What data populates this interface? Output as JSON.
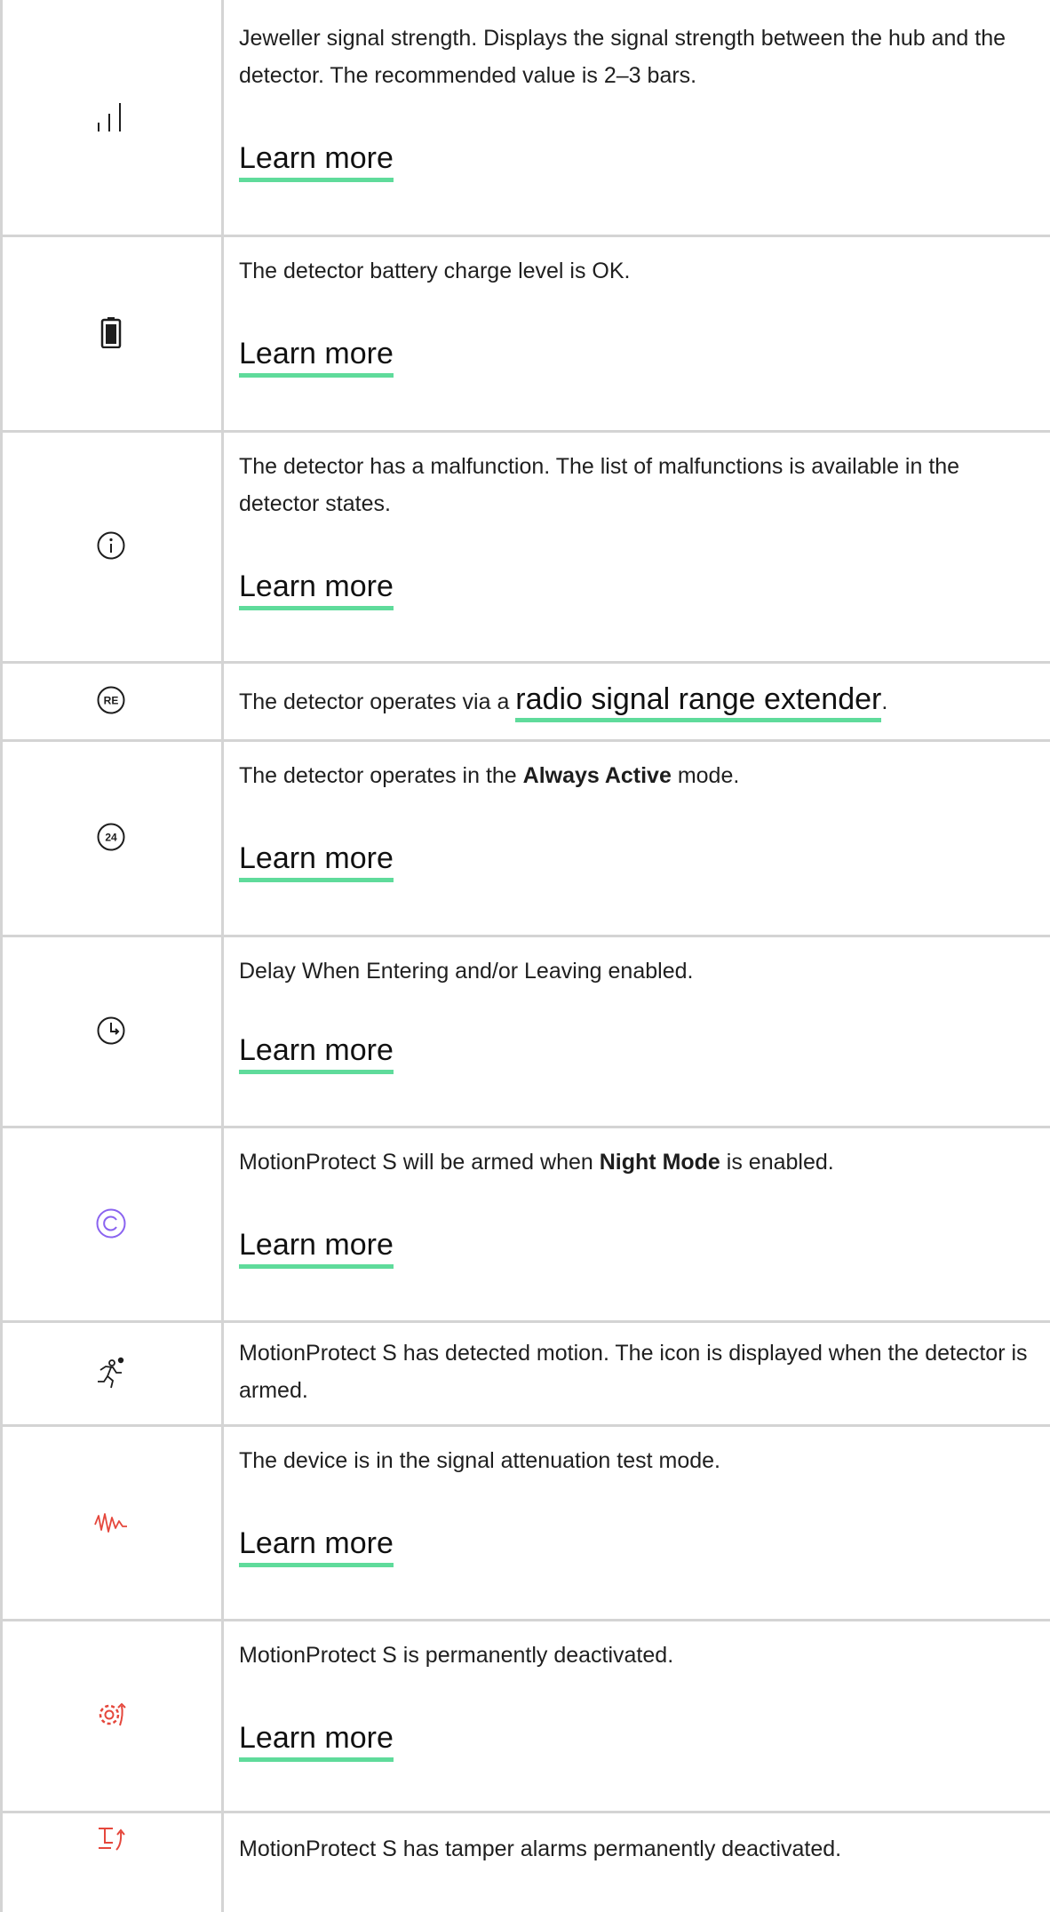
{
  "rows": [
    {
      "icon": "signal-strength-icon",
      "text": "Jeweller signal strength. Displays the signal strength between the hub and the detector. The recommended value is 2–3 bars.",
      "link": "Learn more"
    },
    {
      "icon": "battery-icon",
      "text": "The detector battery charge level is OK.",
      "link": "Learn more"
    },
    {
      "icon": "info-icon",
      "text": "The detector has a malfunction. The list of malfunctions is available in the detector states.",
      "link": "Learn more"
    },
    {
      "icon": "range-extender-icon",
      "icon_label": "RE",
      "text_before": "The detector operates via a ",
      "inline_link": "radio signal range extender",
      "text_after": "."
    },
    {
      "icon": "always-active-24-icon",
      "icon_label": "24",
      "text_before": "The detector operates in the ",
      "bold": "Always Active",
      "text_after": " mode.",
      "link": "Learn more"
    },
    {
      "icon": "delay-clock-icon",
      "text": "Delay When Entering and/or Leaving enabled.",
      "link": "Learn more"
    },
    {
      "icon": "night-mode-icon",
      "text_before": "MotionProtect S will be armed when ",
      "bold": "Night Mode",
      "text_after": " is enabled.",
      "link": "Learn more"
    },
    {
      "icon": "motion-detected-icon",
      "text": "MotionProtect S has detected motion. The icon is displayed when the detector is armed."
    },
    {
      "icon": "signal-attenuation-icon",
      "text": "The device is in the signal attenuation test mode.",
      "link": "Learn more"
    },
    {
      "icon": "permanently-deactivated-icon",
      "text": "MotionProtect S is permanently deactivated.",
      "link": "Learn more"
    },
    {
      "icon": "tamper-deactivated-icon",
      "text": "MotionProtect S has tamper alarms permanently deactivated."
    }
  ],
  "colors": {
    "border": "#d4d4d4",
    "link_underline": "#5fdb9b",
    "night_mode_icon": "#8a63f0",
    "alert_icon": "#e5473c",
    "text": "#1f1f1f"
  }
}
